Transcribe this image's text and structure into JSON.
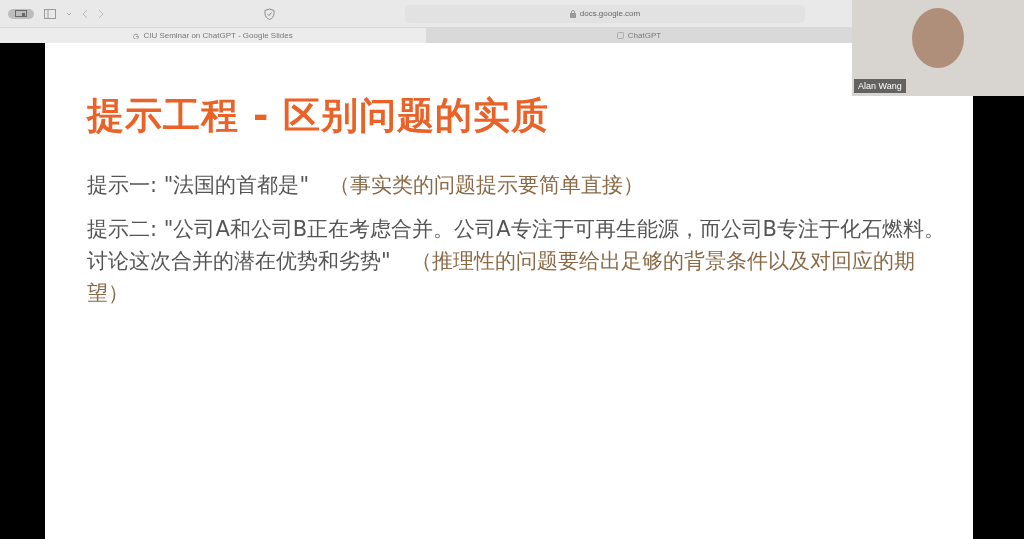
{
  "browser": {
    "address": "docs.google.com",
    "tabs": [
      {
        "label": "CIU Seminar on ChatGPT - Google Slides",
        "selected": true
      },
      {
        "label": "ChatGPT",
        "selected": false
      }
    ]
  },
  "slide": {
    "title": "提示工程 - 区别问题的实质",
    "prompts": [
      {
        "label": "提示一: ",
        "prompt": "\"法国的首都是\"",
        "note": "（事实类的问题提示要简单直接）"
      },
      {
        "label": "提示二: ",
        "prompt": "\"公司A和公司B正在考虑合并。公司A专注于可再生能源，而公司B专注于化石燃料。讨论这次合并的潜在优势和劣势\"",
        "note": "（推理性的问题要给出足够的背景条件以及对回应的期望）"
      }
    ]
  },
  "video": {
    "name": "Alan Wang"
  }
}
